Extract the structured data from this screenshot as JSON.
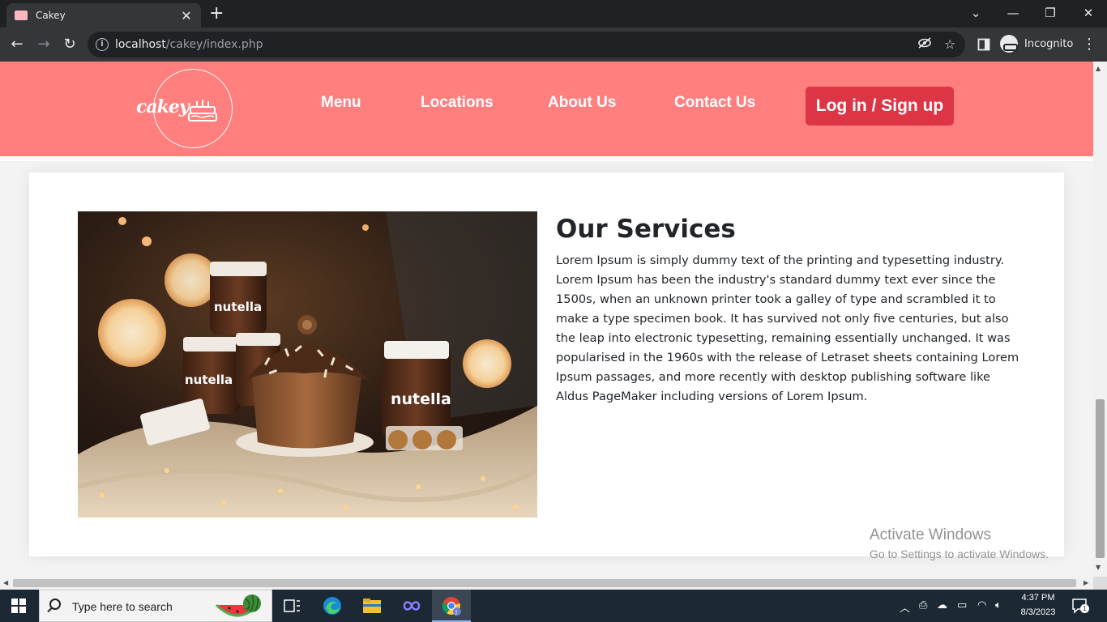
{
  "browser": {
    "tab_title": "Cakey",
    "url_host": "localhost",
    "url_path": "/cakey/index.php",
    "profile_label": "Incognito"
  },
  "site": {
    "logo_text": "cakey",
    "nav": [
      "Menu",
      "Locations",
      "About Us",
      "Contact Us"
    ],
    "login_label": "Log in / Sign up",
    "colors": {
      "header": "#ff7f7f",
      "login_button": "#dc3545"
    }
  },
  "services": {
    "title": "Our Services",
    "body": "Lorem Ipsum is simply dummy text of the printing and typesetting industry. Lorem Ipsum has been the industry's standard dummy text ever since the 1500s, when an unknown printer took a galley of type and scrambled it to make a type specimen book. It has survived not only five centuries, but also the leap into electronic typesetting, remaining essentially unchanged. It was popularised in the 1960s with the release of Letraset sheets containing Lorem Ipsum passages, and more recently with desktop publishing software like Aldus PageMaker including versions of Lorem Ipsum.",
    "photo_jar_label_1": "nutella",
    "photo_jar_label_2": "nutella",
    "photo_jar_label_3": "nutella"
  },
  "watermark": {
    "title": "Activate Windows",
    "subtitle": "Go to Settings to activate Windows."
  },
  "taskbar": {
    "search_placeholder": "Type here to search",
    "time": "4:37 PM",
    "date": "8/3/2023",
    "notification_count": "1"
  }
}
